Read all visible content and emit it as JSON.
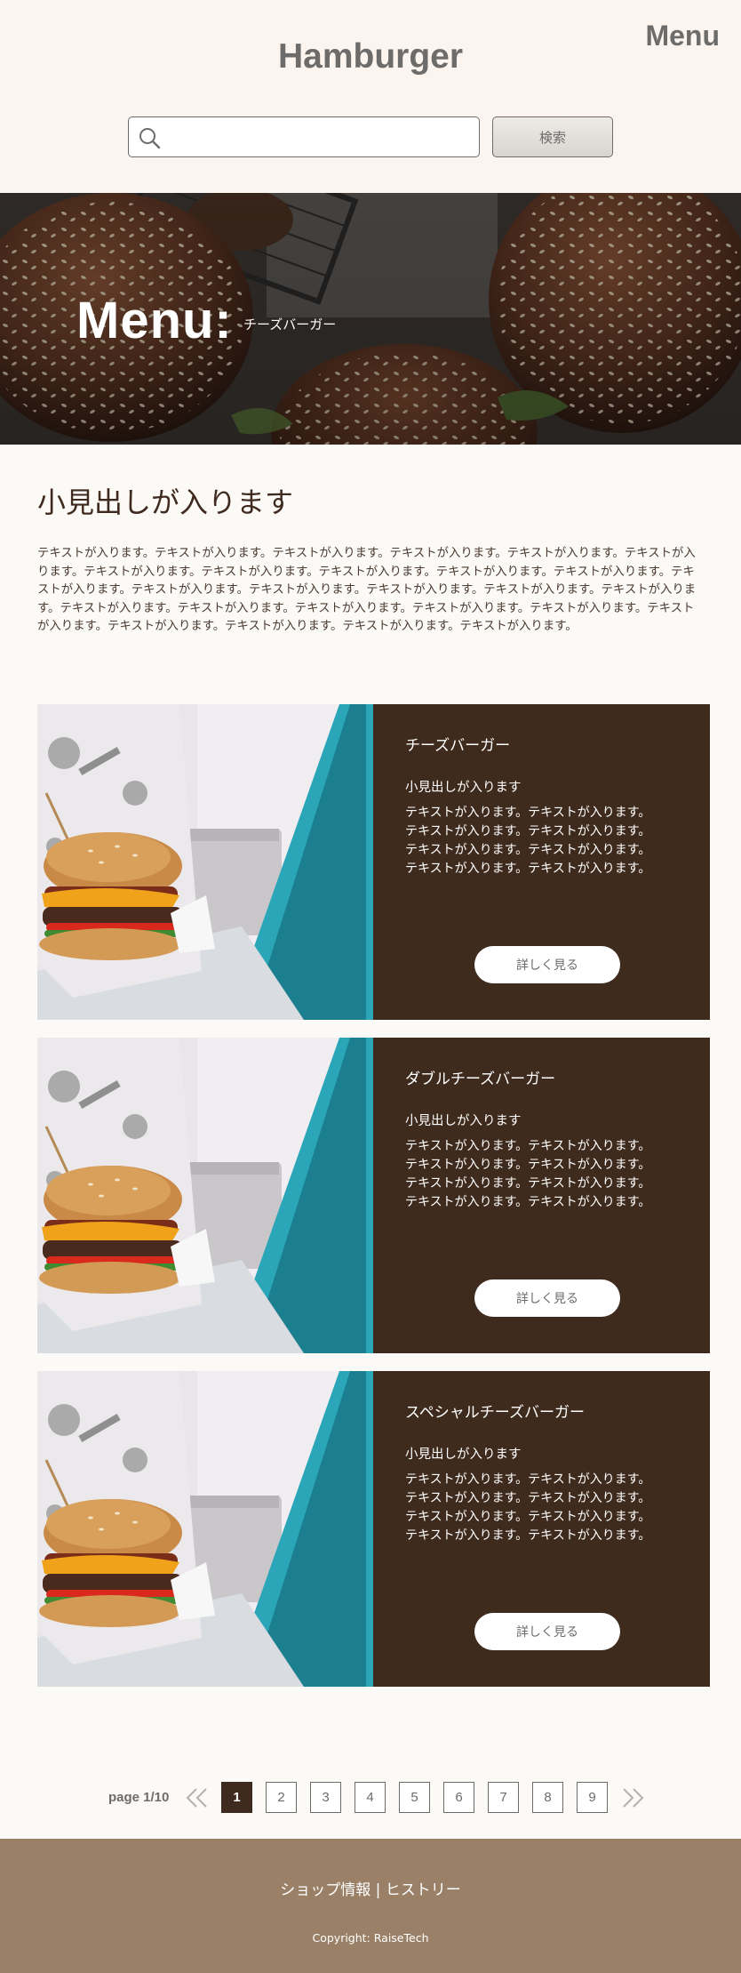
{
  "header": {
    "title": "Hamburger",
    "menu_label": "Menu",
    "search": {
      "placeholder": "",
      "value": ""
    },
    "search_button_label": "検索"
  },
  "hero": {
    "title": "Menu:",
    "subtitle": "チーズバーガー"
  },
  "intro": {
    "heading": "小見出しが入ります",
    "text": "テキストが入ります。テキストが入ります。テキストが入ります。テキストが入ります。テキストが入ります。テキストが入ります。テキストが入ります。テキストが入ります。テキストが入ります。テキストが入ります。テキストが入ります。テキストが入ります。テキストが入ります。テキストが入ります。テキストが入ります。テキストが入ります。テキストが入ります。テキストが入ります。テキストが入ります。テキストが入ります。テキストが入ります。テキストが入ります。テキストが入ります。テキストが入ります。テキストが入ります。テキストが入ります。テキストが入ります。"
  },
  "cards": [
    {
      "title": "チーズバーガー",
      "subtitle": "小見出しが入ります",
      "text": "テキストが入ります。テキストが入ります。テキストが入ります。テキストが入ります。テキストが入ります。テキストが入ります。テキストが入ります。テキストが入ります。",
      "button_label": "詳しく見る"
    },
    {
      "title": "ダブルチーズバーガー",
      "subtitle": "小見出しが入ります",
      "text": "テキストが入ります。テキストが入ります。テキストが入ります。テキストが入ります。テキストが入ります。テキストが入ります。テキストが入ります。テキストが入ります。",
      "button_label": "詳しく見る"
    },
    {
      "title": "スペシャルチーズバーガー",
      "subtitle": "小見出しが入ります",
      "text": "テキストが入ります。テキストが入ります。テキストが入ります。テキストが入ります。テキストが入ります。テキストが入ります。テキストが入ります。テキストが入ります。",
      "button_label": "詳しく見る"
    }
  ],
  "pagination": {
    "info": "page 1/10",
    "pages": [
      "1",
      "2",
      "3",
      "4",
      "5",
      "6",
      "7",
      "8",
      "9"
    ],
    "current": "1"
  },
  "footer": {
    "link_shop": "ショップ情報",
    "separator": "|",
    "link_history": "ヒストリー",
    "copyright": "Copyright: RaiseTech"
  },
  "colors": {
    "header_bg": "#fcf5ef",
    "brand_dark": "#3e2a1f",
    "card_body": "#3f2b1e",
    "footer_bg": "#9b8068",
    "gray_text": "#6d6c6a"
  },
  "icons": {
    "search": "search-icon",
    "prev": "double-chevron-left-icon",
    "next": "double-chevron-right-icon"
  }
}
